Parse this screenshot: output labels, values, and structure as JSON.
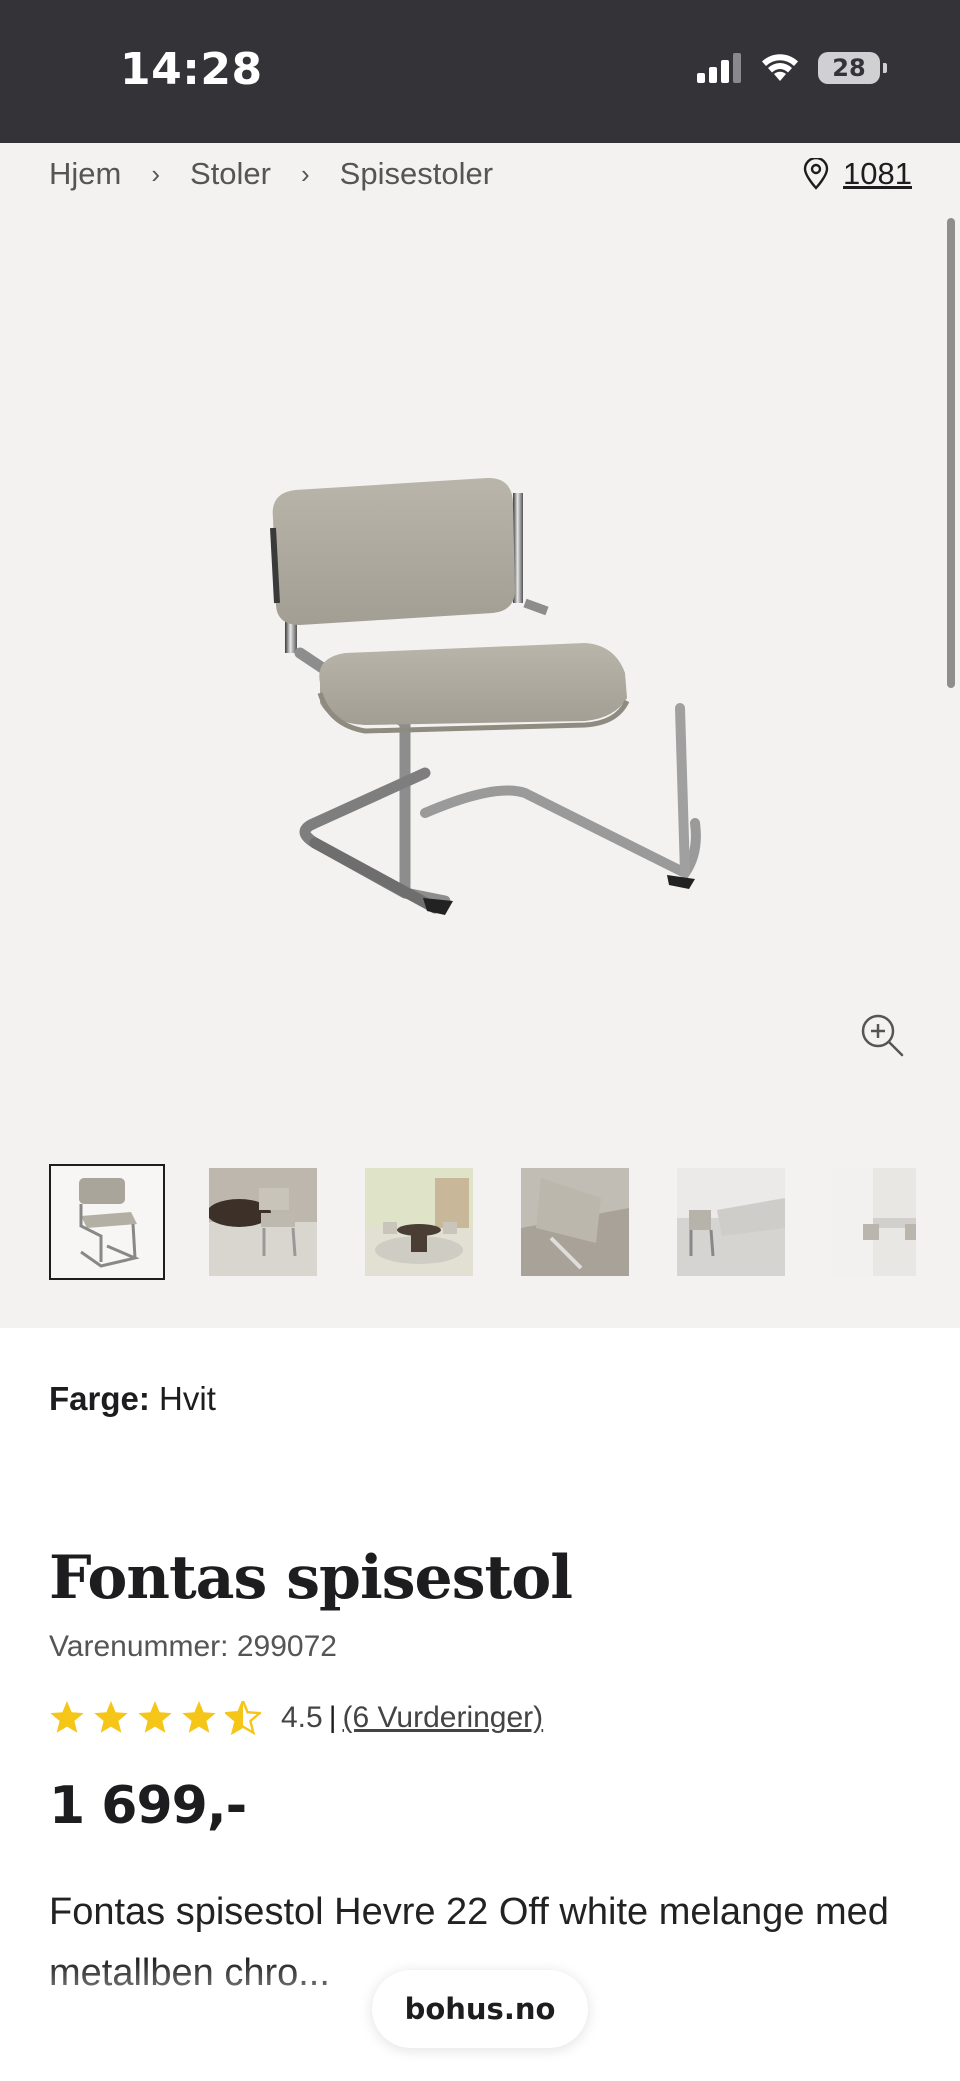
{
  "status_bar": {
    "time": "14:28",
    "battery": "28",
    "icons": [
      "cellular-signal-icon",
      "wifi-icon",
      "battery-icon"
    ]
  },
  "breadcrumb": [
    "Hjem",
    "Stoler",
    "Spisestoler"
  ],
  "location": {
    "code": "1081",
    "icon": "location-pin-icon"
  },
  "gallery": {
    "thumbnail_count": 6,
    "selected_index": 0,
    "zoom_icon": "zoom-in-icon"
  },
  "product": {
    "color_label": "Farge:",
    "color_value": "Hvit",
    "title": "Fontas spisestol",
    "sku": "Varenummer: 299072",
    "rating_value": "4.5",
    "rating_divider": "|",
    "rating_count": "(6 Vurderinger)",
    "rating_stars": 4.5,
    "price": "1 699,-",
    "description": "Fontas spisestol Hevre 22 Off white melange med metallben chro..."
  },
  "browser": {
    "url": "bohus.no"
  },
  "colors": {
    "status_bar": "#333338",
    "gallery_bg": "#f4f2f1",
    "star": "#f5c518",
    "text": "#1d1d1f"
  }
}
